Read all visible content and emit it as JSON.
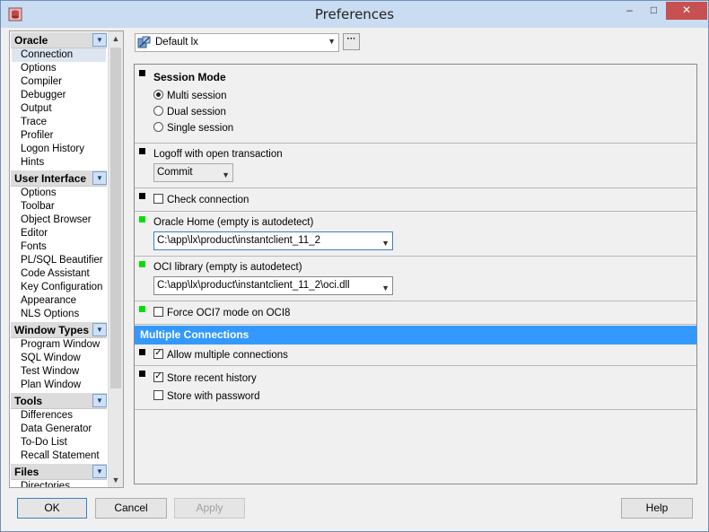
{
  "window": {
    "title": "Preferences",
    "minimize": "‒",
    "maximize": "□",
    "close": "✕"
  },
  "sidebar": {
    "categories": [
      {
        "name": "Oracle",
        "items": [
          "Connection",
          "Options",
          "Compiler",
          "Debugger",
          "Output",
          "Trace",
          "Profiler",
          "Logon History",
          "Hints"
        ]
      },
      {
        "name": "User Interface",
        "items": [
          "Options",
          "Toolbar",
          "Object Browser",
          "Editor",
          "Fonts",
          "PL/SQL Beautifier",
          "Code Assistant",
          "Key Configuration",
          "Appearance",
          "NLS Options"
        ]
      },
      {
        "name": "Window Types",
        "items": [
          "Program Window",
          "SQL Window",
          "Test Window",
          "Plan Window"
        ]
      },
      {
        "name": "Tools",
        "items": [
          "Differences",
          "Data Generator",
          "To-Do List",
          "Recall Statement"
        ]
      },
      {
        "name": "Files",
        "items": [
          "Directories"
        ]
      }
    ],
    "selected": "Connection"
  },
  "profile": {
    "selected": "Default lx",
    "more_label": "···"
  },
  "session": {
    "title": "Session Mode",
    "options": [
      "Multi session",
      "Dual session",
      "Single session"
    ],
    "selected_index": 0
  },
  "logoff": {
    "label": "Logoff with open transaction",
    "value": "Commit"
  },
  "check_connection": {
    "label": "Check connection",
    "checked": false
  },
  "oracle_home": {
    "label": "Oracle Home (empty is autodetect)",
    "value": "C:\\app\\lx\\product\\instantclient_11_2"
  },
  "oci_library": {
    "label": "OCI library (empty is autodetect)",
    "value": "C:\\app\\lx\\product\\instantclient_11_2\\oci.dll"
  },
  "force_oci7": {
    "label": "Force OCI7 mode on OCI8",
    "checked": false
  },
  "multiple": {
    "header": "Multiple Connections",
    "allow": {
      "label": "Allow multiple connections",
      "checked": true
    },
    "store_recent": {
      "label": "Store recent history",
      "checked": true
    },
    "store_password": {
      "label": "Store with password",
      "checked": false
    }
  },
  "buttons": {
    "ok": "OK",
    "cancel": "Cancel",
    "apply": "Apply",
    "help": "Help"
  },
  "colors": {
    "accent": "#3399ff",
    "marker_modified": "#00e000",
    "marker_default": "#000000"
  },
  "icons": {
    "app": "preferences-db-icon",
    "profile": "profile-db-icon",
    "dropdown": "chevron-down-icon",
    "check": "✓",
    "dd": "▼",
    "up": "▲"
  }
}
